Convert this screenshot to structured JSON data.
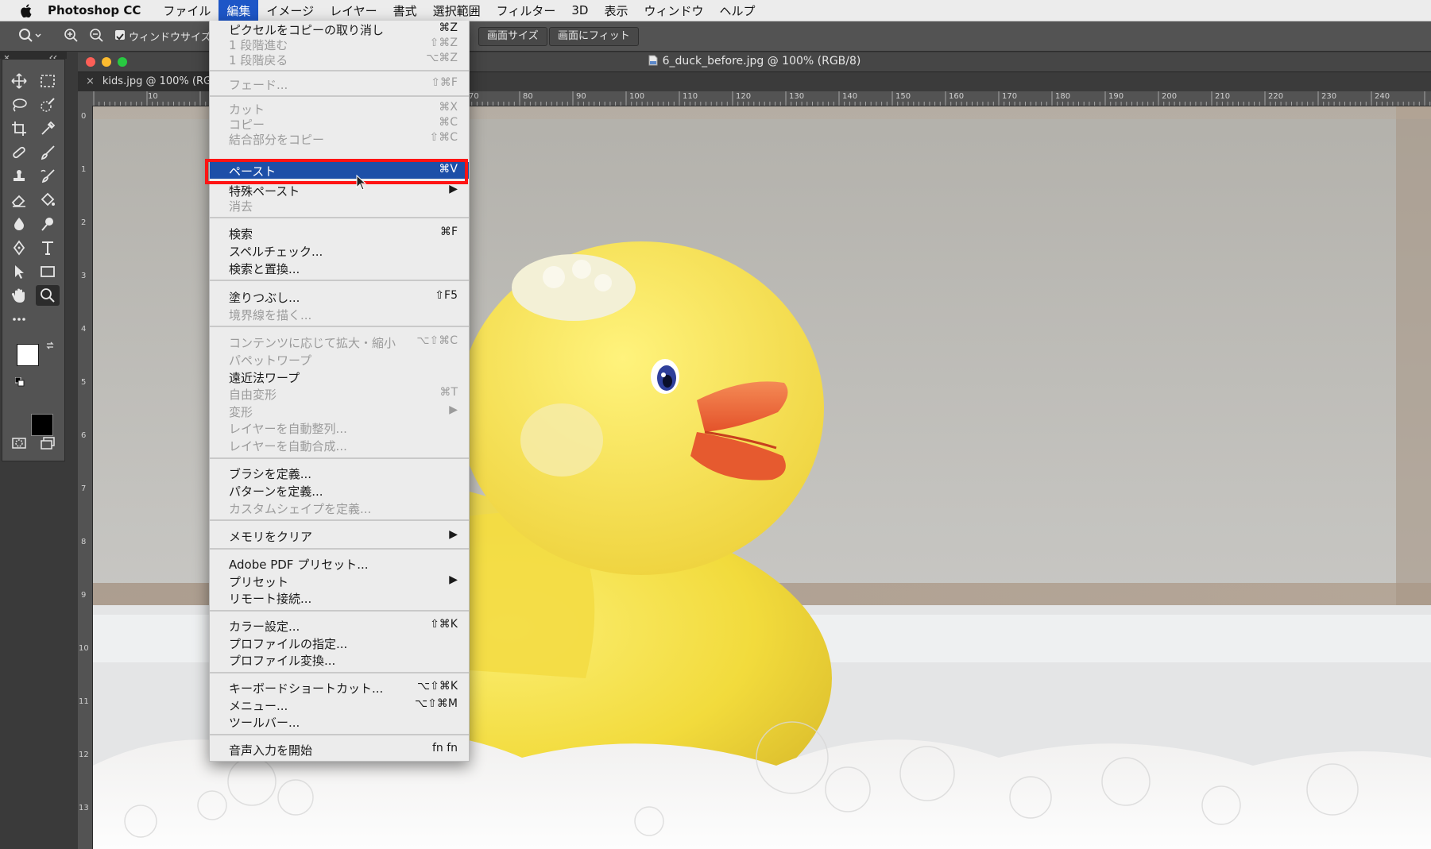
{
  "menubar": {
    "app_name": "Photoshop CC",
    "items": [
      "ファイル",
      "編集",
      "イメージ",
      "レイヤー",
      "書式",
      "選択範囲",
      "フィルター",
      "3D",
      "表示",
      "ウィンドウ",
      "ヘルプ"
    ],
    "active_index": 1
  },
  "options_bar": {
    "checkbox_label": "ウィンドウサイズを",
    "screen_size_button": "画面サイズ",
    "fit_screen_button": "画面にフィット"
  },
  "document": {
    "title": "6_duck_before.jpg @ 100% (RGB/8)",
    "tab_label": "kids.jpg @ 100% (RG",
    "ruler_top": [
      "10",
      "70",
      "80",
      "90",
      "100",
      "110",
      "120",
      "130",
      "140",
      "150",
      "160",
      "170",
      "180",
      "190",
      "200",
      "210",
      "220",
      "230",
      "240"
    ],
    "ruler_left": [
      "0",
      "1",
      "2",
      "3",
      "4",
      "5",
      "6",
      "7",
      "8",
      "9",
      "10",
      "11",
      "12",
      "13"
    ]
  },
  "edit_menu": {
    "items": [
      {
        "label": "ピクセルをコピーの取り消し",
        "shortcut": "⌘Z",
        "disabled": false
      },
      {
        "label": "1 段階進む",
        "shortcut": "⇧⌘Z",
        "disabled": true
      },
      {
        "label": "1 段階戻る",
        "shortcut": "⌥⌘Z",
        "disabled": true
      },
      {
        "label": "フェード...",
        "shortcut": "⇧⌘F",
        "disabled": true
      },
      {
        "label": "カット",
        "shortcut": "⌘X",
        "disabled": true
      },
      {
        "label": "コピー",
        "shortcut": "⌘C",
        "disabled": true
      },
      {
        "label": "結合部分をコピー",
        "shortcut": "⇧⌘C",
        "disabled": true
      },
      {
        "label": "ペースト",
        "shortcut": "⌘V",
        "disabled": false,
        "highlighted": true
      },
      {
        "label": "特殊ペースト",
        "shortcut": "▶",
        "disabled": false
      },
      {
        "label": "消去",
        "shortcut": "",
        "disabled": true
      },
      {
        "label": "検索",
        "shortcut": "⌘F",
        "disabled": false
      },
      {
        "label": "スペルチェック...",
        "shortcut": "",
        "disabled": false
      },
      {
        "label": "検索と置換...",
        "shortcut": "",
        "disabled": false
      },
      {
        "label": "塗りつぶし...",
        "shortcut": "⇧F5",
        "disabled": false
      },
      {
        "label": "境界線を描く...",
        "shortcut": "",
        "disabled": true
      },
      {
        "label": "コンテンツに応じて拡大・縮小",
        "shortcut": "⌥⇧⌘C",
        "disabled": true
      },
      {
        "label": "パペットワープ",
        "shortcut": "",
        "disabled": true
      },
      {
        "label": "遠近法ワープ",
        "shortcut": "",
        "disabled": false
      },
      {
        "label": "自由変形",
        "shortcut": "⌘T",
        "disabled": true
      },
      {
        "label": "変形",
        "shortcut": "▶",
        "disabled": true
      },
      {
        "label": "レイヤーを自動整列...",
        "shortcut": "",
        "disabled": true
      },
      {
        "label": "レイヤーを自動合成...",
        "shortcut": "",
        "disabled": true
      },
      {
        "label": "ブラシを定義...",
        "shortcut": "",
        "disabled": false
      },
      {
        "label": "パターンを定義...",
        "shortcut": "",
        "disabled": false
      },
      {
        "label": "カスタムシェイプを定義...",
        "shortcut": "",
        "disabled": true
      },
      {
        "label": "メモリをクリア",
        "shortcut": "▶",
        "disabled": false
      },
      {
        "label": "Adobe PDF プリセット...",
        "shortcut": "",
        "disabled": false
      },
      {
        "label": "プリセット",
        "shortcut": "▶",
        "disabled": false
      },
      {
        "label": "リモート接続...",
        "shortcut": "",
        "disabled": false
      },
      {
        "label": "カラー設定...",
        "shortcut": "⇧⌘K",
        "disabled": false
      },
      {
        "label": "プロファイルの指定...",
        "shortcut": "",
        "disabled": false
      },
      {
        "label": "プロファイル変換...",
        "shortcut": "",
        "disabled": false
      },
      {
        "label": "キーボードショートカット...",
        "shortcut": "⌥⇧⌘K",
        "disabled": false
      },
      {
        "label": "メニュー...",
        "shortcut": "⌥⇧⌘M",
        "disabled": false
      },
      {
        "label": "ツールバー...",
        "shortcut": "",
        "disabled": false
      },
      {
        "label": "音声入力を開始",
        "shortcut": "fn fn",
        "disabled": false
      }
    ]
  },
  "colors": {
    "menu_highlight": "#1d4fa8",
    "annotation_box": "#ff1414",
    "duck_yellow": "#f4e14a",
    "beak_orange": "#ef6a35"
  }
}
